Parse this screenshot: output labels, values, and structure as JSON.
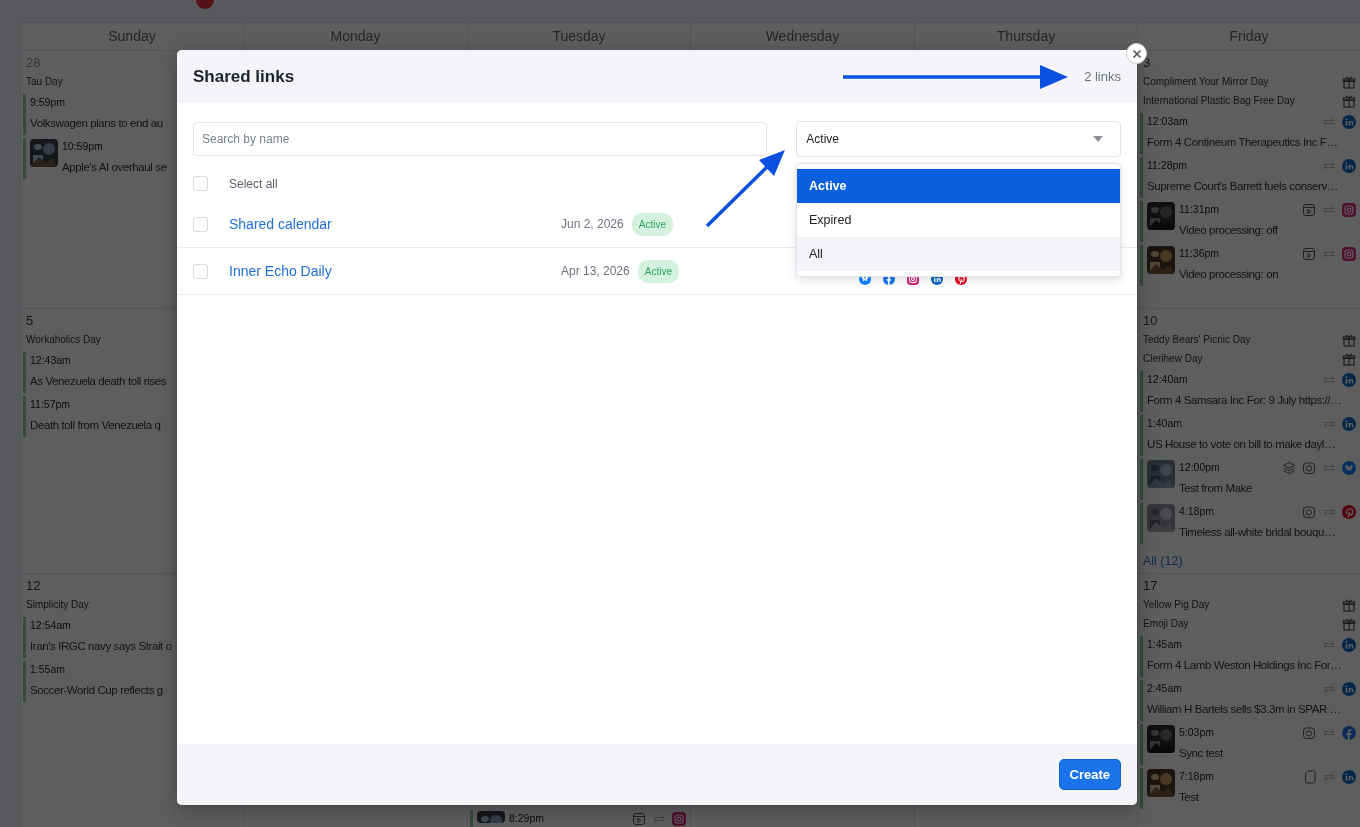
{
  "calendar": {
    "weekdays": [
      "Sunday",
      "Monday",
      "Tuesday",
      "Wednesday",
      "Thursday",
      "Friday"
    ],
    "weeks": [
      {
        "sunday": {
          "date": "28",
          "other_month": true,
          "items": [
            {
              "kind": "holiday",
              "title": "Tau Day"
            },
            {
              "kind": "post",
              "time": "9:59pm",
              "title": "Volkswagen plans to end au",
              "thumbnail": false
            },
            {
              "kind": "post",
              "time": "10:59pm",
              "title": "Apple's AI overhaul se",
              "thumbnail": true
            }
          ]
        },
        "friday": {
          "date": "3",
          "other_month": false,
          "items": [
            {
              "kind": "holiday",
              "title": "Compliment Your Mirror Day"
            },
            {
              "kind": "holiday",
              "title": "International Plastic Bag Free Day"
            },
            {
              "kind": "post",
              "time": "12:03am",
              "title": "Form 4 Contineum Therapeutics Inc F…",
              "thumbnail": false,
              "icons": [
                {
                  "kind": "linkedin"
                }
              ]
            },
            {
              "kind": "post",
              "time": "11:28pm",
              "title": "Supreme Court's Barrett fuels conserv…",
              "thumbnail": false,
              "icons": [
                {
                  "kind": "linkedin"
                }
              ]
            },
            {
              "kind": "post",
              "time": "11:31pm",
              "title": "Video processing: off",
              "thumbnail": true,
              "icons": [
                {
                  "kind": "reel"
                },
                {
                  "kind": "instagram"
                }
              ]
            },
            {
              "kind": "post",
              "time": "11:36pm",
              "title": "Video processing: on",
              "thumbnail": true,
              "icons": [
                {
                  "kind": "reel"
                },
                {
                  "kind": "instagram"
                }
              ]
            }
          ]
        }
      },
      {
        "sunday": {
          "date": "5",
          "other_month": false,
          "items": [
            {
              "kind": "holiday",
              "title": "Workaholics Day"
            },
            {
              "kind": "post",
              "time": "12:43am",
              "title": "As Venezuela death toll rises",
              "thumbnail": false
            },
            {
              "kind": "post",
              "time": "11:57pm",
              "title": "Death toll from Venezuela q",
              "thumbnail": false
            }
          ]
        },
        "friday": {
          "date": "10",
          "other_month": false,
          "more": "All (12)",
          "items": [
            {
              "kind": "holiday",
              "title": "Teddy Bears' Picnic Day"
            },
            {
              "kind": "holiday",
              "title": "Clerihew Day"
            },
            {
              "kind": "post",
              "time": "12:40am",
              "title": "Form 4 Samsara Inc For: 9 July https://…",
              "thumbnail": false,
              "icons": [
                {
                  "kind": "linkedin"
                }
              ]
            },
            {
              "kind": "post",
              "time": "1:40am",
              "title": "US House to vote on bill to make dayl…",
              "thumbnail": false,
              "icons": [
                {
                  "kind": "linkedin"
                }
              ]
            },
            {
              "kind": "post",
              "time": "12:00pm",
              "title": "Test from Make",
              "thumbnail": true,
              "icons": [
                {
                  "kind": "layers"
                },
                {
                  "kind": "camera"
                },
                {
                  "kind": "bluesky"
                }
              ]
            },
            {
              "kind": "post",
              "time": "4:18pm",
              "title": "Timeless all-white bridal bouqu…",
              "thumbnail": true,
              "icons": [
                {
                  "kind": "camera"
                },
                {
                  "kind": "pinterest"
                }
              ]
            }
          ]
        }
      },
      {
        "sunday": {
          "date": "12",
          "other_month": false,
          "items": [
            {
              "kind": "holiday",
              "title": "Simplicity Day"
            },
            {
              "kind": "post",
              "time": "12:54am",
              "title": "Iran's IRGC navy says Strait o",
              "thumbnail": false
            },
            {
              "kind": "post",
              "time": "1:55am",
              "title": "Soccer-World Cup reflects g",
              "thumbnail": false
            }
          ]
        },
        "tuesday": {
          "items": [
            {
              "kind": "post",
              "time": "8:29pm",
              "thumbnail": true,
              "icons": [
                {
                  "kind": "reel"
                },
                {
                  "kind": "instagram"
                }
              ]
            }
          ]
        },
        "friday": {
          "date": "17",
          "other_month": false,
          "items": [
            {
              "kind": "holiday",
              "title": "Yellow Pig Day"
            },
            {
              "kind": "holiday",
              "title": "Emoji Day"
            },
            {
              "kind": "post",
              "time": "1:45am",
              "title": "Form 4 Lamb Weston Holdings Inc For…",
              "thumbnail": false,
              "icons": [
                {
                  "kind": "linkedin"
                }
              ]
            },
            {
              "kind": "post",
              "time": "2:45am",
              "title": "William H Bartels sells $3.3m in SPAR …",
              "thumbnail": false,
              "icons": [
                {
                  "kind": "linkedin"
                }
              ]
            },
            {
              "kind": "post",
              "time": "5:03pm",
              "title": "Sync test",
              "thumbnail": true,
              "icons": [
                {
                  "kind": "camera"
                },
                {
                  "kind": "facebook"
                }
              ]
            },
            {
              "kind": "post",
              "time": "7:18pm",
              "title": "Test",
              "thumbnail": true,
              "icons": [
                {
                  "kind": "document"
                },
                {
                  "kind": "linkedin"
                }
              ]
            }
          ]
        }
      }
    ]
  },
  "modal": {
    "title": "Shared links",
    "count": "2 links",
    "search": {
      "placeholder": "Search by name"
    },
    "filter": {
      "value": "Active",
      "open": true,
      "options": [
        {
          "label": "Active",
          "selected": true,
          "hovered": false
        },
        {
          "label": "Expired",
          "selected": false,
          "hovered": false
        },
        {
          "label": "All",
          "selected": false,
          "hovered": true
        }
      ]
    },
    "select_all": {
      "label": "Select all",
      "checked": false
    },
    "links": [
      {
        "name": "Shared calendar",
        "date": "Jun 2, 2026",
        "status": "Active",
        "checked": false
      },
      {
        "name": "Inner Echo Daily",
        "date": "Apr 13, 2026",
        "status": "Active",
        "checked": false,
        "networks": [
          {
            "kind": "bluesky"
          },
          {
            "kind": "facebook"
          },
          {
            "kind": "instagram"
          },
          {
            "kind": "linkedin"
          },
          {
            "kind": "pinterest"
          }
        ]
      }
    ],
    "create_button": "Create"
  }
}
